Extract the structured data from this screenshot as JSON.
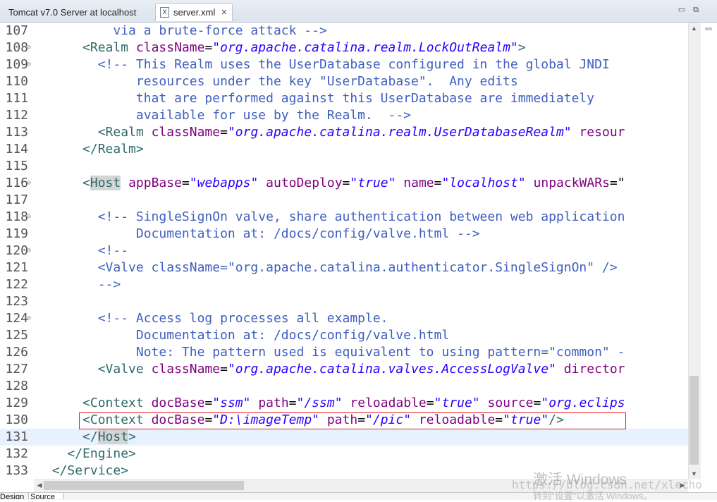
{
  "tabs": [
    {
      "label": "Tomcat v7.0 Server at localhost",
      "active": false
    },
    {
      "label": "server.xml",
      "active": true
    }
  ],
  "icons": {
    "file": "xml-file-icon",
    "close": "close-icon",
    "minimize": "minimize-icon",
    "restore": "restore-icon"
  },
  "colors": {
    "comment": "#3f5fbf",
    "tag": "#2f6b6b",
    "attribute": "#7f007f",
    "value": "#2a00ff",
    "current_line": "#e8f2fe",
    "highlight_box": "#e02020"
  },
  "lines": [
    {
      "n": "107",
      "fold": false,
      "current": false,
      "tokens": [
        {
          "c": "comment",
          "t": "          via a brute-force attack -->"
        }
      ]
    },
    {
      "n": "108",
      "fold": true,
      "current": false,
      "tokens": [
        {
          "c": "plain",
          "t": "      "
        },
        {
          "c": "tag",
          "t": "<Realm "
        },
        {
          "c": "attr",
          "t": "className"
        },
        {
          "c": "plain",
          "t": "="
        },
        {
          "c": "val",
          "t": "\"org.apache.catalina.realm.LockOutRealm\""
        },
        {
          "c": "tag",
          "t": ">"
        }
      ]
    },
    {
      "n": "109",
      "fold": true,
      "current": false,
      "tokens": [
        {
          "c": "comment",
          "t": "        <!-- This Realm uses the UserDatabase configured in the global JNDI"
        }
      ]
    },
    {
      "n": "110",
      "fold": false,
      "current": false,
      "tokens": [
        {
          "c": "comment",
          "t": "             resources under the key \"UserDatabase\".  Any edits"
        }
      ]
    },
    {
      "n": "111",
      "fold": false,
      "current": false,
      "tokens": [
        {
          "c": "comment",
          "t": "             that are performed against this UserDatabase are immediately"
        }
      ]
    },
    {
      "n": "112",
      "fold": false,
      "current": false,
      "tokens": [
        {
          "c": "comment",
          "t": "             available for use by the Realm.  -->"
        }
      ]
    },
    {
      "n": "113",
      "fold": false,
      "current": false,
      "tokens": [
        {
          "c": "plain",
          "t": "        "
        },
        {
          "c": "tag",
          "t": "<Realm "
        },
        {
          "c": "attr",
          "t": "className"
        },
        {
          "c": "plain",
          "t": "="
        },
        {
          "c": "val",
          "t": "\"org.apache.catalina.realm.UserDatabaseRealm\""
        },
        {
          "c": "plain",
          "t": " "
        },
        {
          "c": "attr",
          "t": "resour"
        }
      ]
    },
    {
      "n": "114",
      "fold": false,
      "current": false,
      "tokens": [
        {
          "c": "plain",
          "t": "      "
        },
        {
          "c": "tag",
          "t": "</Realm>"
        }
      ]
    },
    {
      "n": "115",
      "fold": false,
      "current": false,
      "tokens": []
    },
    {
      "n": "116",
      "fold": true,
      "current": false,
      "tokens": [
        {
          "c": "plain",
          "t": "      "
        },
        {
          "c": "tag",
          "t": "<"
        },
        {
          "c": "taghl",
          "t": "Host"
        },
        {
          "c": "plain",
          "t": " "
        },
        {
          "c": "attr",
          "t": "appBase"
        },
        {
          "c": "plain",
          "t": "="
        },
        {
          "c": "val",
          "t": "\"webapps\""
        },
        {
          "c": "plain",
          "t": " "
        },
        {
          "c": "attr",
          "t": "autoDeploy"
        },
        {
          "c": "plain",
          "t": "="
        },
        {
          "c": "val",
          "t": "\"true\""
        },
        {
          "c": "plain",
          "t": " "
        },
        {
          "c": "attr",
          "t": "name"
        },
        {
          "c": "plain",
          "t": "="
        },
        {
          "c": "val",
          "t": "\"localhost\""
        },
        {
          "c": "plain",
          "t": " "
        },
        {
          "c": "attr",
          "t": "unpackWARs"
        },
        {
          "c": "plain",
          "t": "=\""
        }
      ]
    },
    {
      "n": "117",
      "fold": false,
      "current": false,
      "tokens": []
    },
    {
      "n": "118",
      "fold": true,
      "current": false,
      "tokens": [
        {
          "c": "comment",
          "t": "        <!-- SingleSignOn valve, share authentication between web application"
        }
      ]
    },
    {
      "n": "119",
      "fold": false,
      "current": false,
      "tokens": [
        {
          "c": "comment",
          "t": "             Documentation at: /docs/config/valve.html -->"
        }
      ]
    },
    {
      "n": "120",
      "fold": true,
      "current": false,
      "tokens": [
        {
          "c": "comment",
          "t": "        <!--"
        }
      ]
    },
    {
      "n": "121",
      "fold": false,
      "current": false,
      "tokens": [
        {
          "c": "comment",
          "t": "        <Valve className=\"org.apache.catalina.authenticator.SingleSignOn\" />"
        }
      ]
    },
    {
      "n": "122",
      "fold": false,
      "current": false,
      "tokens": [
        {
          "c": "comment",
          "t": "        -->"
        }
      ]
    },
    {
      "n": "123",
      "fold": false,
      "current": false,
      "tokens": []
    },
    {
      "n": "124",
      "fold": true,
      "current": false,
      "tokens": [
        {
          "c": "comment",
          "t": "        <!-- Access log processes all example."
        }
      ]
    },
    {
      "n": "125",
      "fold": false,
      "current": false,
      "tokens": [
        {
          "c": "comment",
          "t": "             Documentation at: /docs/config/valve.html"
        }
      ]
    },
    {
      "n": "126",
      "fold": false,
      "current": false,
      "tokens": [
        {
          "c": "comment",
          "t": "             Note: The pattern used is equivalent to using pattern=\"common\" -"
        }
      ]
    },
    {
      "n": "127",
      "fold": false,
      "current": false,
      "tokens": [
        {
          "c": "plain",
          "t": "        "
        },
        {
          "c": "tag",
          "t": "<Valve "
        },
        {
          "c": "attr",
          "t": "className"
        },
        {
          "c": "plain",
          "t": "="
        },
        {
          "c": "val",
          "t": "\"org.apache.catalina.valves.AccessLogValve\""
        },
        {
          "c": "plain",
          "t": " "
        },
        {
          "c": "attr",
          "t": "director"
        }
      ]
    },
    {
      "n": "128",
      "fold": false,
      "current": false,
      "tokens": []
    },
    {
      "n": "129",
      "fold": false,
      "current": false,
      "tokens": [
        {
          "c": "plain",
          "t": "      "
        },
        {
          "c": "tag",
          "t": "<Context "
        },
        {
          "c": "attr",
          "t": "docBase"
        },
        {
          "c": "plain",
          "t": "="
        },
        {
          "c": "val",
          "t": "\"ssm\""
        },
        {
          "c": "plain",
          "t": " "
        },
        {
          "c": "attr",
          "t": "path"
        },
        {
          "c": "plain",
          "t": "="
        },
        {
          "c": "val",
          "t": "\"/ssm\""
        },
        {
          "c": "plain",
          "t": " "
        },
        {
          "c": "attr",
          "t": "reloadable"
        },
        {
          "c": "plain",
          "t": "="
        },
        {
          "c": "val",
          "t": "\"true\""
        },
        {
          "c": "plain",
          "t": " "
        },
        {
          "c": "attr",
          "t": "source"
        },
        {
          "c": "plain",
          "t": "="
        },
        {
          "c": "val",
          "t": "\"org.eclips"
        }
      ]
    },
    {
      "n": "130",
      "fold": false,
      "current": false,
      "tokens": [
        {
          "c": "plain",
          "t": "      "
        },
        {
          "c": "tag",
          "t": "<Context "
        },
        {
          "c": "attr",
          "t": "docBase"
        },
        {
          "c": "plain",
          "t": "="
        },
        {
          "c": "val",
          "t": "\"D:\\imageTemp\""
        },
        {
          "c": "plain",
          "t": " "
        },
        {
          "c": "attr",
          "t": "path"
        },
        {
          "c": "plain",
          "t": "="
        },
        {
          "c": "val",
          "t": "\"/pic\""
        },
        {
          "c": "plain",
          "t": " "
        },
        {
          "c": "attr",
          "t": "reloadable"
        },
        {
          "c": "plain",
          "t": "="
        },
        {
          "c": "val",
          "t": "\"true\""
        },
        {
          "c": "tag",
          "t": "/>"
        }
      ]
    },
    {
      "n": "131",
      "fold": false,
      "current": true,
      "tokens": [
        {
          "c": "plain",
          "t": "      "
        },
        {
          "c": "tag",
          "t": "</"
        },
        {
          "c": "taghl",
          "t": "Host"
        },
        {
          "c": "tag",
          "t": ">"
        }
      ]
    },
    {
      "n": "132",
      "fold": false,
      "current": false,
      "tokens": [
        {
          "c": "plain",
          "t": "    "
        },
        {
          "c": "tag",
          "t": "</Engine>"
        }
      ]
    },
    {
      "n": "133",
      "fold": false,
      "current": false,
      "tokens": [
        {
          "c": "plain",
          "t": "  "
        },
        {
          "c": "tag",
          "t": "</Service>"
        }
      ]
    }
  ],
  "bottom_tabs": [
    {
      "label": "Design",
      "active": false
    },
    {
      "label": "Source",
      "active": true
    }
  ],
  "watermark": {
    "activate": "激活 Windows",
    "url": "https://blog.csdn.net/xlecho",
    "hint": "转到\"设置\"以激活 Windows。"
  }
}
